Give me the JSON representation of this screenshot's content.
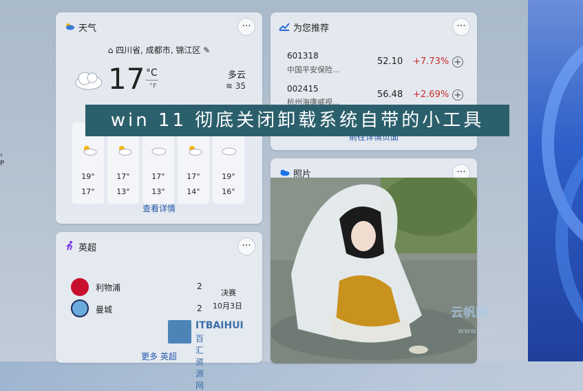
{
  "banner": {
    "text": "win 11 彻底关闭卸载系统自带的小工具"
  },
  "weather": {
    "title": "天气",
    "location": "四川省, 成都市, 锦江区",
    "temperature": "17",
    "unit_c": "°C",
    "unit_f": "°F",
    "condition": "多云",
    "aqi": "35",
    "forecast": [
      {
        "hi": "19°",
        "lo": "17°"
      },
      {
        "hi": "17°",
        "lo": "13°"
      },
      {
        "hi": "17°",
        "lo": "13°"
      },
      {
        "hi": "17°",
        "lo": "14°"
      },
      {
        "hi": "19°",
        "lo": "16°"
      }
    ],
    "link": "查看详情"
  },
  "stocks": {
    "title": "为您推荐",
    "items": [
      {
        "code": "601318",
        "name": "中国平安保险...",
        "price": "52.10",
        "change": "+7.73%"
      },
      {
        "code": "002415",
        "name": "杭州海康威视...",
        "price": "56.48",
        "change": "+2.69%"
      }
    ],
    "link": "前往详情页面"
  },
  "photos": {
    "title": "照片"
  },
  "football": {
    "title": "英超",
    "teams": [
      {
        "name": "利物浦",
        "score": "2"
      },
      {
        "name": "曼城",
        "score": "2"
      }
    ],
    "status": "决赛",
    "date": "10月3日",
    "link": "更多 英超"
  },
  "common": {
    "more_label": "···"
  },
  "watermarks": {
    "brand": "ITBAIHUI",
    "brand_cn": "百汇资源网",
    "site": "云帆网",
    "site_url": "www.yfxyfun.com"
  },
  "colors": {
    "banner_bg": "#2c5f6c",
    "stock_up": "#c62d2d",
    "link": "#2559a8"
  }
}
